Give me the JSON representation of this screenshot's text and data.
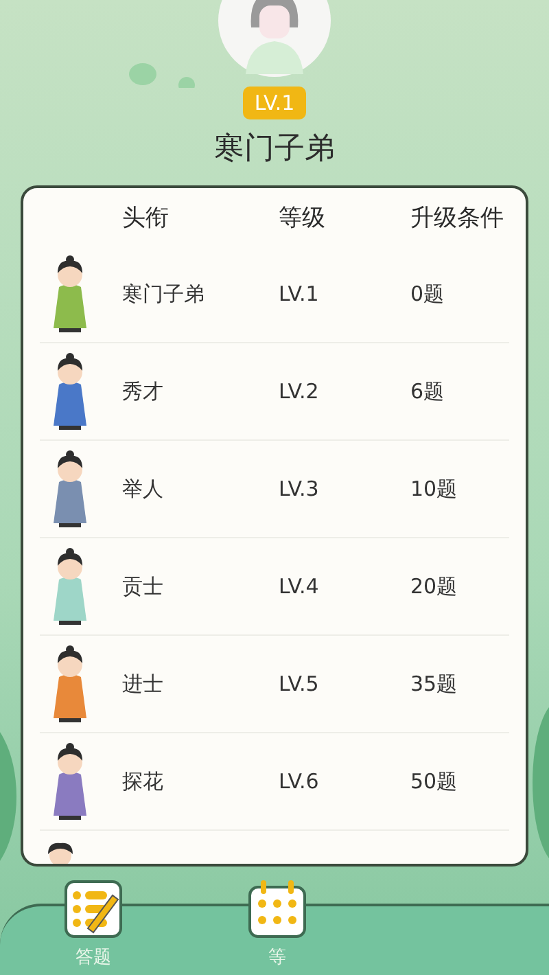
{
  "profile": {
    "level_badge": "LV.1",
    "title": "寒门子弟"
  },
  "table": {
    "columns": [
      "头衔",
      "等级",
      "升级条件"
    ],
    "rows": [
      {
        "title": "寒门子弟",
        "level": "LV.1",
        "condition": "0题",
        "color": "#8dbb4c"
      },
      {
        "title": "秀才",
        "level": "LV.2",
        "condition": "6题",
        "color": "#4a78c8"
      },
      {
        "title": "举人",
        "level": "LV.3",
        "condition": "10题",
        "color": "#7a8fb0"
      },
      {
        "title": "贡士",
        "level": "LV.4",
        "condition": "20题",
        "color": "#9ed6c8"
      },
      {
        "title": "进士",
        "level": "LV.5",
        "condition": "35题",
        "color": "#e8893a"
      },
      {
        "title": "探花",
        "level": "LV.6",
        "condition": "50题",
        "color": "#8a7bc0"
      }
    ]
  },
  "nav": [
    {
      "label": "答题",
      "kind": "quiz"
    },
    {
      "label": "等",
      "kind": "calendar"
    }
  ]
}
